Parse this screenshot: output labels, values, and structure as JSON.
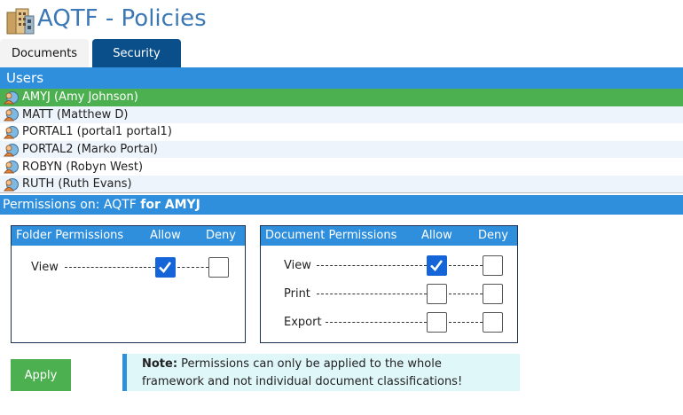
{
  "app": {
    "title": "AQTF - Policies",
    "logo_icon": "building-logo-icon"
  },
  "tabs": [
    {
      "label": "Documents",
      "active": false
    },
    {
      "label": "Security",
      "active": true
    }
  ],
  "users": {
    "header": "Users",
    "items": [
      {
        "label": "AMYJ (Amy Johnson)",
        "selected": true,
        "icon": "user-icon"
      },
      {
        "label": "MATT (Matthew D)",
        "selected": false,
        "icon": "user-icon"
      },
      {
        "label": "PORTAL1 (portal1 portal1)",
        "selected": false,
        "icon": "user-icon"
      },
      {
        "label": "PORTAL2 (Marko Portal)",
        "selected": false,
        "icon": "user-icon"
      },
      {
        "label": "ROBYN (Robyn West)",
        "selected": false,
        "icon": "user-icon"
      },
      {
        "label": "RUTH (Ruth Evans)",
        "selected": false,
        "icon": "user-icon"
      }
    ]
  },
  "permissions": {
    "header_prefix": "Permissions on: AQTF",
    "header_user": "for AMYJ",
    "folder": {
      "title": "Folder Permissions",
      "allow_label": "Allow",
      "deny_label": "Deny",
      "rows": [
        {
          "label": "View",
          "allow": true,
          "deny": false
        }
      ]
    },
    "document": {
      "title": "Document Permissions",
      "allow_label": "Allow",
      "deny_label": "Deny",
      "rows": [
        {
          "label": "View",
          "allow": true,
          "deny": false
        },
        {
          "label": "Print",
          "allow": false,
          "deny": false
        },
        {
          "label": "Export",
          "allow": false,
          "deny": false
        }
      ]
    }
  },
  "actions": {
    "apply_label": "Apply"
  },
  "note": {
    "bold": "Note:",
    "line1": " Permissions can only be applied to the whole",
    "line2": "framework and not individual document classifications!"
  },
  "colors": {
    "accent_blue": "#2f8fdd",
    "tab_active": "#0b4f8a",
    "selected_green": "#4caf50",
    "checkbox_checked": "#1565d8",
    "note_bg": "#e0f7fa",
    "title_blue": "#3b78b5"
  }
}
